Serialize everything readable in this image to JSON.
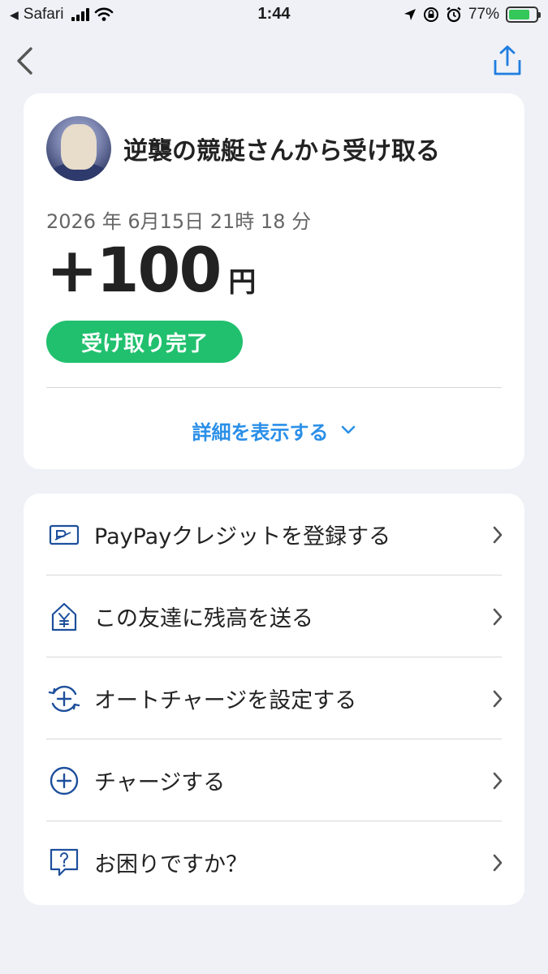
{
  "status_bar": {
    "back_app": "Safari",
    "time": "1:44",
    "battery_percent": "77%",
    "battery_level": 0.77
  },
  "transaction": {
    "title": "逆襲の競艇さんから受け取る",
    "date": "2026 年 6月15日 21時 18 分",
    "amount": "+100",
    "currency": "円",
    "status": "受け取り完了",
    "details_label": "詳細を表示する"
  },
  "menu": [
    {
      "icon": "paypay-credit-card-icon",
      "label": "PayPayクレジットを登録する"
    },
    {
      "icon": "yen-house-icon",
      "label": "この友達に残高を送る"
    },
    {
      "icon": "auto-charge-icon",
      "label": "オートチャージを設定する"
    },
    {
      "icon": "plus-circle-icon",
      "label": "チャージする"
    },
    {
      "icon": "question-bubble-icon",
      "label": "お困りですか？"
    }
  ],
  "colors": {
    "accent_blue": "#2a8fe8",
    "icon_navy": "#1d4f9c",
    "status_green": "#21c06e",
    "background": "#eff1f6"
  }
}
